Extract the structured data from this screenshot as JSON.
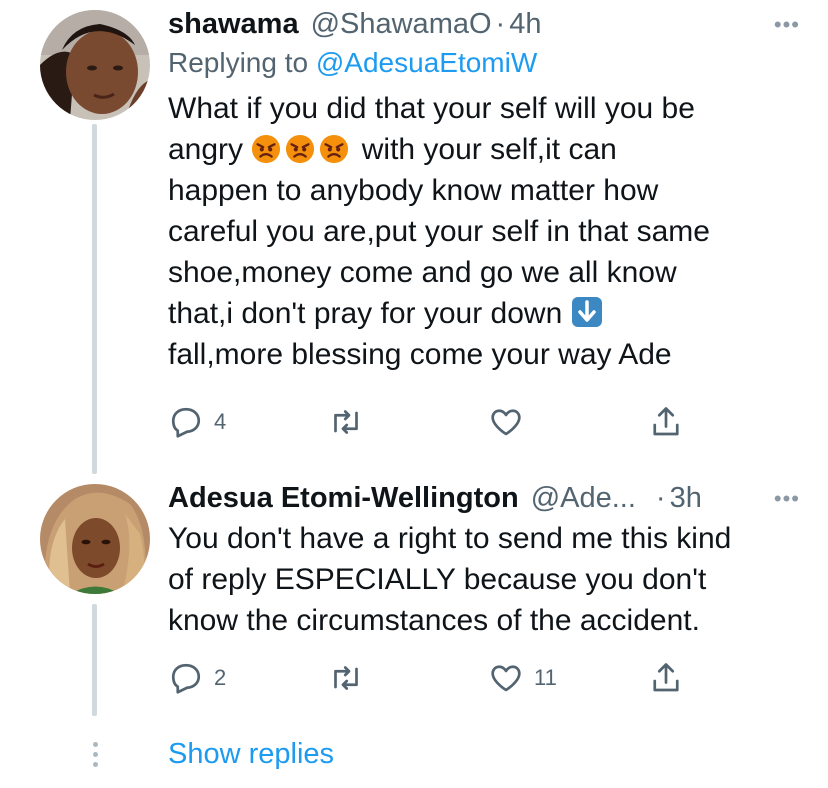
{
  "tweets": [
    {
      "name": "shawama",
      "handle": "@ShawamaO",
      "separator": "·",
      "time": "4h",
      "more_label": "•••",
      "replying_prefix": "Replying to",
      "replying_handle": "@AdesuaEtomiW",
      "text_lines": [
        "What if you did that your self will you be",
        "angry",
        "with your self,it can",
        "happen to anybody know matter how",
        "careful you are,put your self in that same",
        "shoe,money come and go we all know",
        "that,i don't pray for your down",
        "fall,more blessing come your way Ade"
      ],
      "emojis": [
        "angry-face",
        "angry-face",
        "angry-face",
        "down-arrow"
      ],
      "actions": {
        "reply_count": "4",
        "retweet_count": "",
        "like_count": ""
      }
    },
    {
      "name": "Adesua Etomi-Wellington",
      "handle": "@Ade...",
      "separator": "·",
      "time": "3h",
      "more_label": "•••",
      "text_lines": [
        "You don't have a right to send me this kind",
        "of reply ESPECIALLY because you don't",
        "know the circumstances of the accident."
      ],
      "actions": {
        "reply_count": "2",
        "retweet_count": "",
        "like_count": "11"
      }
    }
  ],
  "show_replies": "Show replies",
  "colors": {
    "link": "#1d9bf0",
    "secondary": "#536471",
    "thread_line": "#cfd9de",
    "emoji": "#f4900c"
  }
}
